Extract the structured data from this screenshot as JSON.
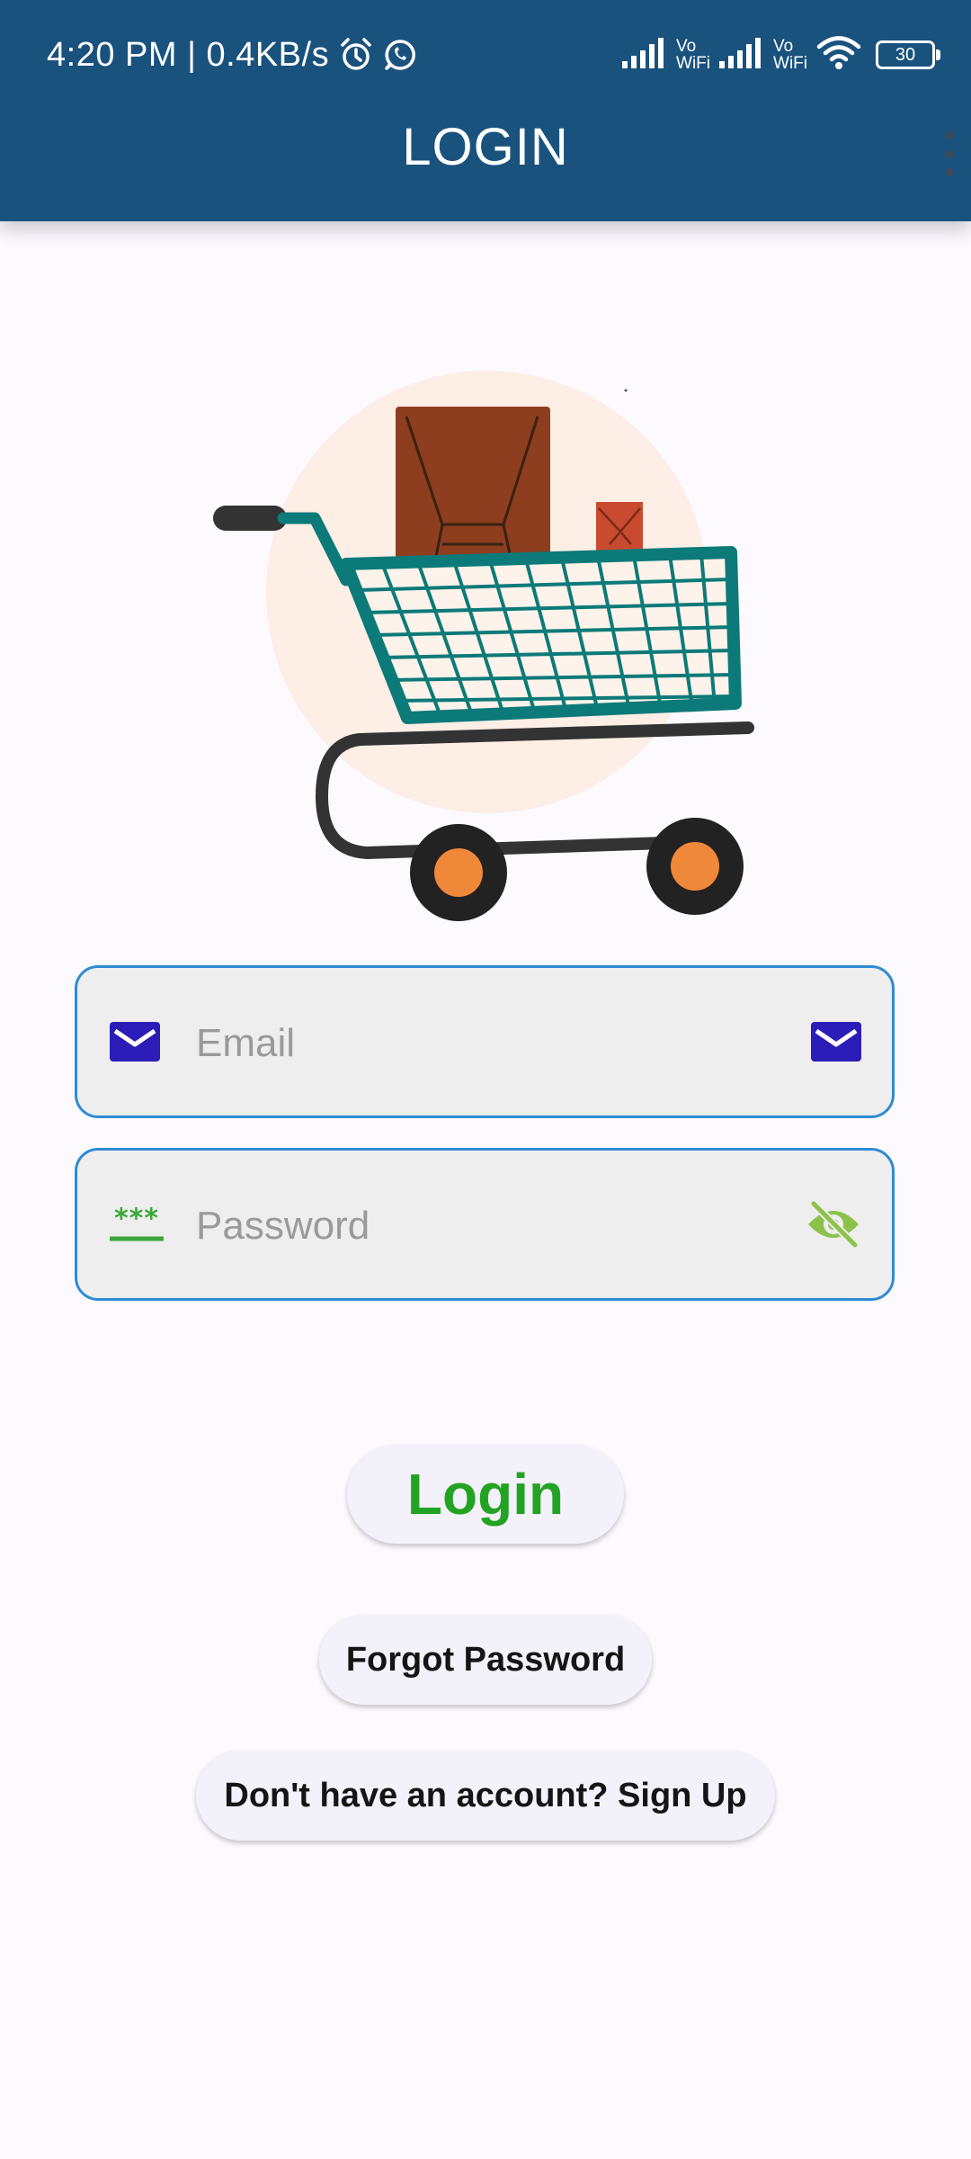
{
  "status_bar": {
    "time": "4:20 PM | 0.4KB/s",
    "vowifi_1": "Vo WiFi",
    "vowifi_2": "Vo WiFi",
    "battery": "30"
  },
  "app_bar": {
    "title": "LOGIN"
  },
  "form": {
    "email_placeholder": "Email",
    "email_value": "",
    "password_placeholder": "Password",
    "password_value": "",
    "password_prefix_glyph": "***"
  },
  "buttons": {
    "login": "Login",
    "forgot_password": "Forgot Password",
    "signup": "Don't have an account? Sign Up"
  },
  "colors": {
    "app_bar": "#1a527e",
    "email_icon": "#2c1cb8",
    "password_icon": "#3aa83a",
    "visibility_icon": "#8bc34a",
    "login_text": "#23a323",
    "field_border": "#2f8bd4"
  },
  "icons": [
    "alarm-icon",
    "whatsapp-icon",
    "signal-icon",
    "wifi-icon",
    "battery-icon",
    "overflow-menu-icon",
    "email-icon",
    "password-icon",
    "visibility-off-icon",
    "shopping-cart-illustration"
  ]
}
